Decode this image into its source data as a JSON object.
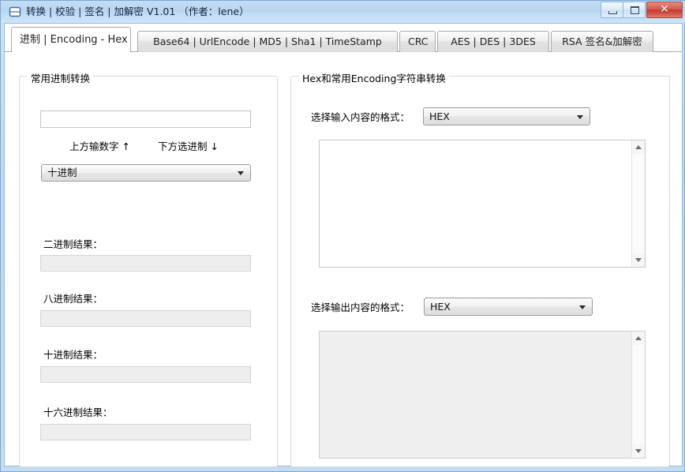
{
  "window": {
    "title": "转换 | 校验 | 签名 | 加解密 V1.01 （作者：lene）",
    "icon": "app-window-icon",
    "buttons": {
      "minimize": "minimize-icon",
      "maximize": "maximize-icon",
      "close": "✕"
    },
    "accent_blue": "#bcd8f2",
    "close_red": "#c0392c"
  },
  "tabs": [
    {
      "label": "进制 | Encoding - Hex",
      "active": true
    },
    {
      "label": "Base64 | UrlEncode | MD5 | Sha1 | TimeStamp",
      "active": false
    },
    {
      "label": "CRC",
      "active": false
    },
    {
      "label": "AES | DES | 3DES",
      "active": false
    },
    {
      "label": "RSA 签名&加解密",
      "active": false
    }
  ],
  "left_panel": {
    "title": "常用进制转换",
    "number_input": {
      "value": "",
      "placeholder": ""
    },
    "hint_up": "上方输数字 ↑",
    "hint_down": "下方选进制 ↓",
    "base_select": {
      "value": "十进制",
      "arrow": "chevron-down-icon"
    },
    "results": [
      {
        "label": "二进制结果：",
        "value": ""
      },
      {
        "label": "八进制结果：",
        "value": ""
      },
      {
        "label": "十进制结果：",
        "value": ""
      },
      {
        "label": "十六进制结果：",
        "value": ""
      }
    ]
  },
  "right_panel": {
    "title": "Hex和常用Encoding字符串转换",
    "input_format_label": "选择输入内容的格式：",
    "input_format_select": {
      "value": "HEX",
      "arrow": "chevron-down-icon"
    },
    "input_textarea": {
      "value": ""
    },
    "output_format_label": "选择输出内容的格式：",
    "output_format_select": {
      "value": "HEX",
      "arrow": "chevron-down-icon"
    },
    "output_textarea": {
      "value": ""
    },
    "scrollbar": {
      "up": "scroll-up-icon",
      "down": "scroll-down-icon"
    }
  }
}
